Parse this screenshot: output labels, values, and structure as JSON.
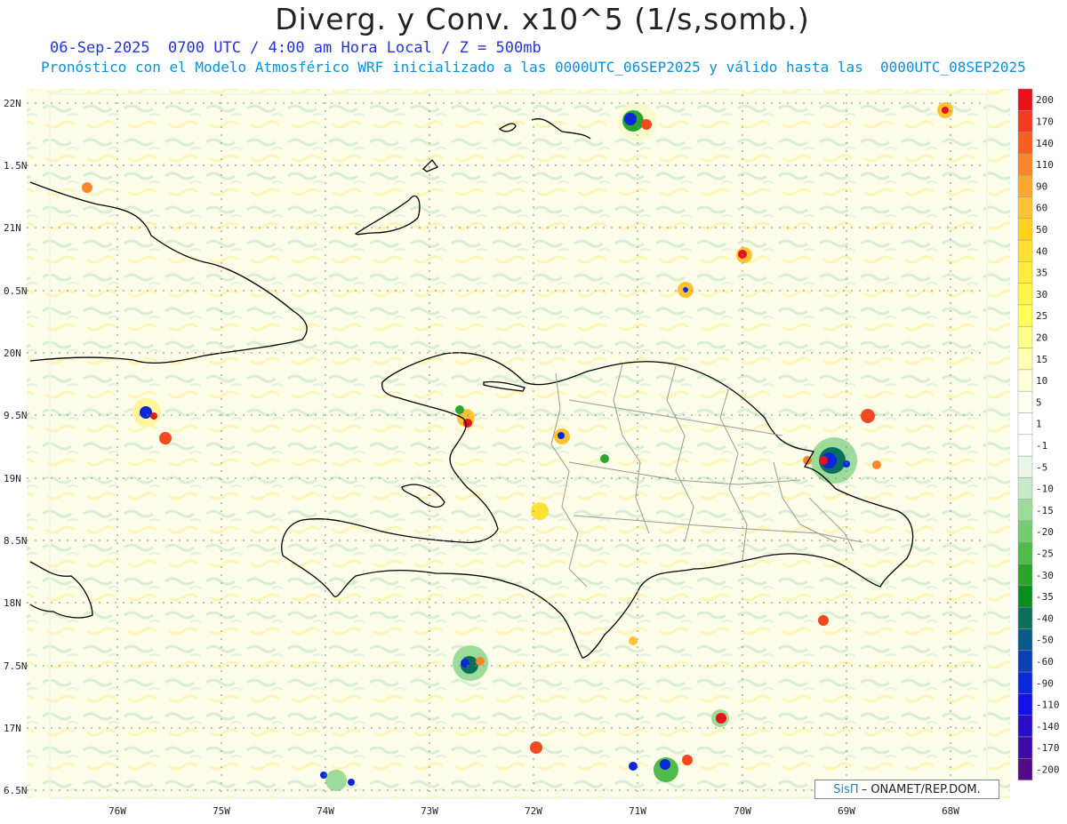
{
  "title": "Diverg. y Conv. x10^5 (1/s,somb.)",
  "subtitle_date": "06-Sep-2025  0700 UTC / 4:00 am Hora Local / Z = 500mb",
  "subtitle_model": "Pronóstico con el Modelo Atmosférico WRF inicializado a las 0000UTC_06SEP2025 y válido hasta las  0000UTC_08SEP2025",
  "lat_labels": [
    "22N",
    "1.5N",
    "21N",
    "0.5N",
    "20N",
    "9.5N",
    "19N",
    "8.5N",
    "18N",
    "7.5N",
    "17N",
    "6.5N"
  ],
  "lon_labels": [
    "76W",
    "75W",
    "74W",
    "73W",
    "72W",
    "71W",
    "70W",
    "69W",
    "68W"
  ],
  "colorbar": {
    "labels": [
      "200",
      "170",
      "140",
      "110",
      "90",
      "60",
      "50",
      "40",
      "35",
      "30",
      "25",
      "20",
      "15",
      "10",
      "5",
      "1",
      "-1",
      "-5",
      "-10",
      "-15",
      "-20",
      "-25",
      "-30",
      "-35",
      "-40",
      "-50",
      "-60",
      "-90",
      "-110",
      "-140",
      "-170",
      "-200"
    ],
    "colors": [
      "#e8121c",
      "#f23b20",
      "#f56123",
      "#f98628",
      "#fca82e",
      "#fdc333",
      "#ffd21e",
      "#ffe033",
      "#ffec3c",
      "#fff54a",
      "#ffff59",
      "#ffff8a",
      "#ffffb2",
      "#ffffd8",
      "#ffffee",
      "#ffffff",
      "#ffffff",
      "#e8f6e8",
      "#c6eac5",
      "#9ddb9b",
      "#74cb72",
      "#4ebb4c",
      "#2aa42a",
      "#0a8c24",
      "#0b6f5a",
      "#0a5a88",
      "#0a3fb5",
      "#0a27d8",
      "#1410e8",
      "#2a0cc6",
      "#3e0aa5",
      "#520a88"
    ]
  },
  "credit": {
    "logo": "SisΠ",
    "text": "– ONAMET/REP.DOM."
  },
  "colors": {
    "ocean_bg": "#fbfde8",
    "land_bg": "#f4f9e6",
    "coast": "#000000",
    "province": "#9a9a9a"
  }
}
